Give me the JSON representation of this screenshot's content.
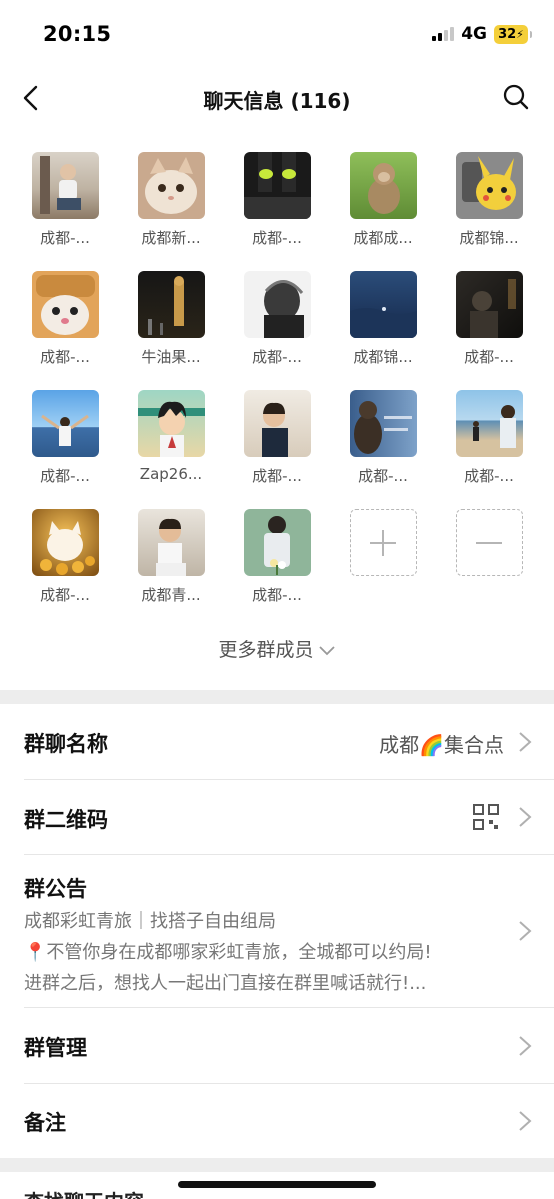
{
  "status": {
    "time": "20:15",
    "network": "4G",
    "battery": "32"
  },
  "nav": {
    "title": "聊天信息 (116)"
  },
  "members": [
    {
      "name": "成都-...",
      "avatar": "person-sitting-avatar"
    },
    {
      "name": "成都新...",
      "avatar": "cat-avatar"
    },
    {
      "name": "成都-...",
      "avatar": "legs-socks-avatar"
    },
    {
      "name": "成都成...",
      "avatar": "monkey-avatar"
    },
    {
      "name": "成都锦...",
      "avatar": "pikachu-avatar"
    },
    {
      "name": "成都-...",
      "avatar": "cat-toast-avatar"
    },
    {
      "name": "牛油果...",
      "avatar": "night-statue-avatar"
    },
    {
      "name": "成都-...",
      "avatar": "bw-hair-avatar"
    },
    {
      "name": "成都锦...",
      "avatar": "ocean-avatar"
    },
    {
      "name": "成都-...",
      "avatar": "dark-room-avatar"
    },
    {
      "name": "成都-...",
      "avatar": "beach-man-avatar"
    },
    {
      "name": "Zap26...",
      "avatar": "anime-boy-avatar"
    },
    {
      "name": "成都-...",
      "avatar": "boy-portrait-avatar"
    },
    {
      "name": "成都-...",
      "avatar": "bear-window-avatar"
    },
    {
      "name": "成都-...",
      "avatar": "beach-couple-avatar"
    },
    {
      "name": "成都-...",
      "avatar": "gold-cat-avatar"
    },
    {
      "name": "成都青...",
      "avatar": "child-avatar"
    },
    {
      "name": "成都-...",
      "avatar": "flowers-back-avatar"
    }
  ],
  "more_members": "更多群成员",
  "settings": {
    "group_name_label": "群聊名称",
    "group_name_value": "成都🌈集合点",
    "qr_label": "群二维码",
    "notice_label": "群公告",
    "notice_line1": "成都彩虹青旅｜找搭子自由组局",
    "notice_line2": "📍不管你身在成都哪家彩虹青旅，全城都可以约局!",
    "notice_line3": "进群之后，想找人一起出门直接在群里喊话就行!...",
    "manage_label": "群管理",
    "remark_label": "备注",
    "next_label": "查找聊天内容"
  },
  "colors": {
    "divider_band": "#ededed",
    "text_secondary": "#777777"
  }
}
